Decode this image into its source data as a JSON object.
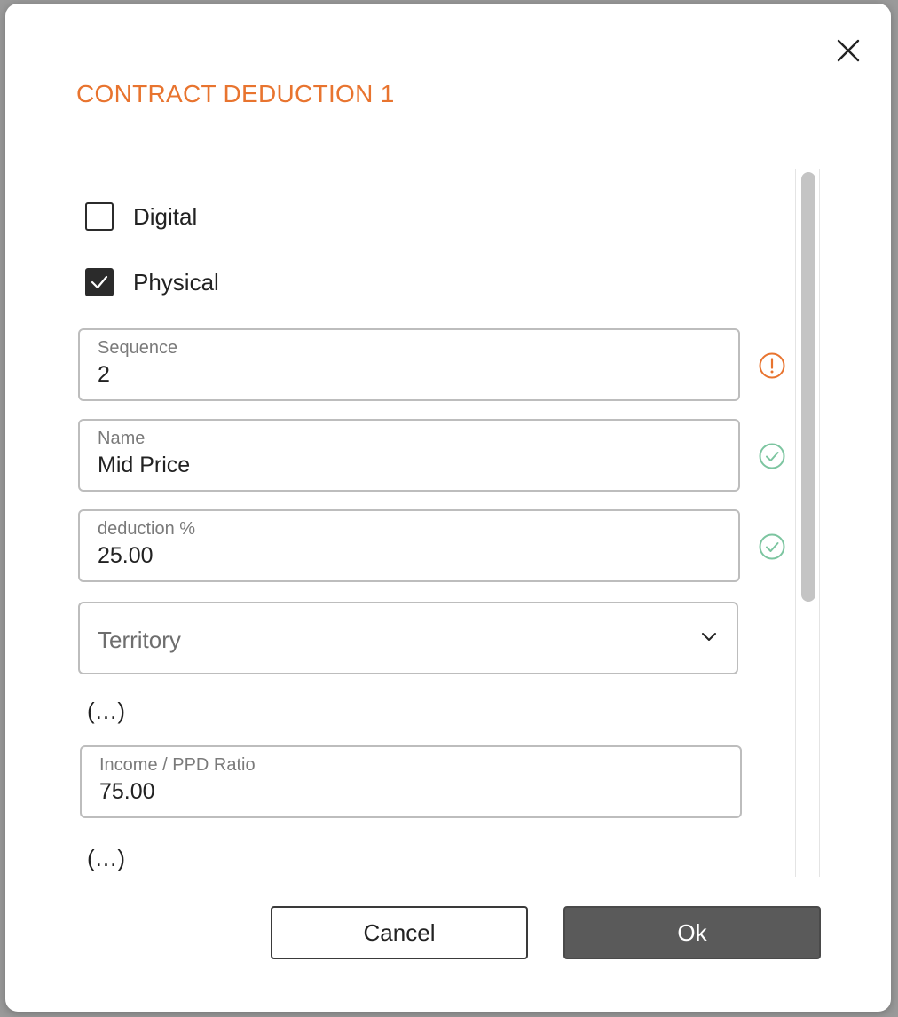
{
  "dialog": {
    "title": "CONTRACT DEDUCTION 1",
    "close_icon": "close-icon"
  },
  "checkboxes": [
    {
      "label": "Digital",
      "checked": false
    },
    {
      "label": "Physical",
      "checked": true
    }
  ],
  "fields": {
    "sequence": {
      "label": "Sequence",
      "value": "2",
      "status": "warning",
      "status_icon": "exclamation-circle-icon"
    },
    "name": {
      "label": "Name",
      "value": "Mid Price",
      "status": "valid",
      "status_icon": "check-circle-icon"
    },
    "deduction": {
      "label": "deduction %",
      "value": "25.00",
      "status": "valid",
      "status_icon": "check-circle-icon"
    },
    "territory": {
      "placeholder": "Territory",
      "icon": "chevron-down-icon"
    },
    "income_ratio": {
      "label": "Income / PPD Ratio",
      "value": "75.00"
    }
  },
  "ellipsis_1": "(...)",
  "ellipsis_2": "(...)",
  "buttons": {
    "cancel": "Cancel",
    "ok": "Ok"
  },
  "colors": {
    "accent": "#e8742f",
    "valid": "#7cc5a0",
    "warning": "#e8742f",
    "primary_button": "#5a5a5a"
  }
}
